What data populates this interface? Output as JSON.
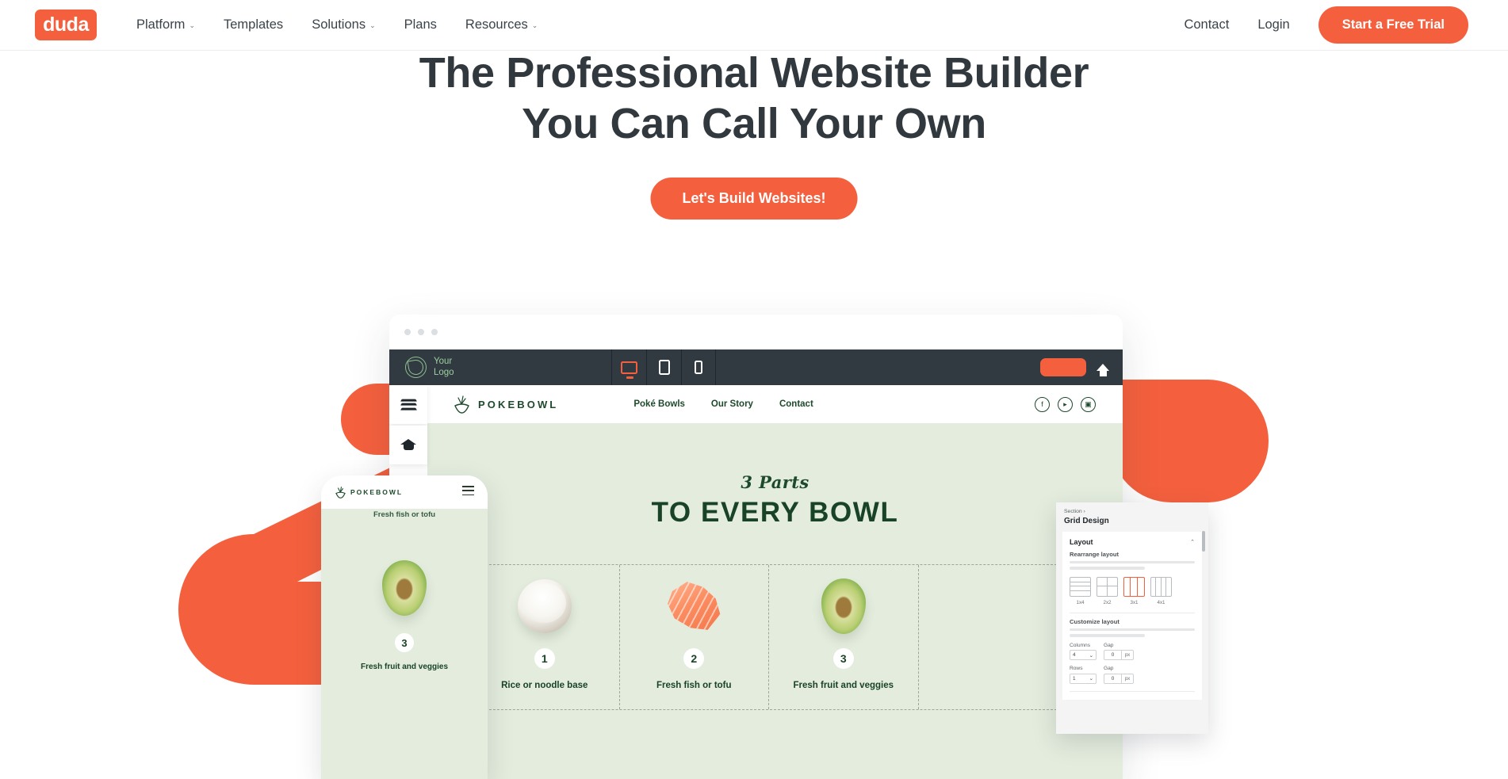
{
  "header": {
    "logo_text": "duda",
    "nav": [
      {
        "label": "Platform",
        "has_caret": true
      },
      {
        "label": "Templates",
        "has_caret": false
      },
      {
        "label": "Solutions",
        "has_caret": true
      },
      {
        "label": "Plans",
        "has_caret": false
      },
      {
        "label": "Resources",
        "has_caret": true
      }
    ],
    "contact_label": "Contact",
    "login_label": "Login",
    "trial_label": "Start a Free Trial",
    "caret_glyph": "⌄"
  },
  "hero": {
    "title_line1": "The Professional Website Builder",
    "title_line2": "You Can Call Your Own",
    "cta_label": "Let's Build Websites!"
  },
  "editor": {
    "logo_line1": "Your",
    "logo_line2": "Logo",
    "devices": [
      {
        "name": "desktop",
        "active": true
      },
      {
        "name": "tablet",
        "active": false
      },
      {
        "name": "mobile",
        "active": false
      }
    ],
    "rail": [
      {
        "icon": "layers-icon"
      },
      {
        "icon": "graduation-cap-icon"
      }
    ]
  },
  "site": {
    "brand": "POKEBOWL",
    "nav": [
      "Poké Bowls",
      "Our Story",
      "Contact"
    ],
    "socials": [
      {
        "name": "facebook-icon",
        "glyph": "f"
      },
      {
        "name": "youtube-icon",
        "glyph": "▸"
      },
      {
        "name": "instagram-icon",
        "glyph": "▣"
      }
    ],
    "section": {
      "script_title": "3 Parts",
      "main_title": "TO EVERY BOWL",
      "cards": [
        {
          "number": "1",
          "label": "Rice or noodle base",
          "image": "rice-bowl-image"
        },
        {
          "number": "2",
          "label": "Fresh fish or tofu",
          "image": "salmon-image"
        },
        {
          "number": "3",
          "label": "Fresh fruit and veggies",
          "image": "avocado-image"
        }
      ]
    }
  },
  "phone": {
    "brand": "POKEBOWL",
    "clipped_label": "Fresh fish or tofu",
    "number": "3",
    "label": "Fresh fruit and veggies"
  },
  "panel": {
    "breadcrumb": "Section ›",
    "title": "Grid Design",
    "layout_heading": "Layout",
    "collapse_glyph": "⌃",
    "rearrange_heading": "Rearrange layout",
    "layout_options": [
      {
        "caption": "1x4",
        "selected": false
      },
      {
        "caption": "2x2",
        "selected": false
      },
      {
        "caption": "3x1",
        "selected": true
      },
      {
        "caption": "4x1",
        "selected": false
      }
    ],
    "customize_heading": "Customize layout",
    "columns_label": "Columns",
    "columns_value": "4",
    "columns_gap_label": "Gap",
    "columns_gap_value": "0",
    "columns_gap_unit": "px",
    "rows_label": "Rows",
    "rows_value": "1",
    "rows_gap_label": "Gap",
    "rows_gap_value": "0",
    "rows_gap_unit": "px",
    "dropdown_glyph": "⌄"
  },
  "colors": {
    "brand_orange": "#f4603e",
    "dark_slate": "#313a40",
    "canvas_green": "#e3ecdd",
    "deep_green": "#184326"
  }
}
